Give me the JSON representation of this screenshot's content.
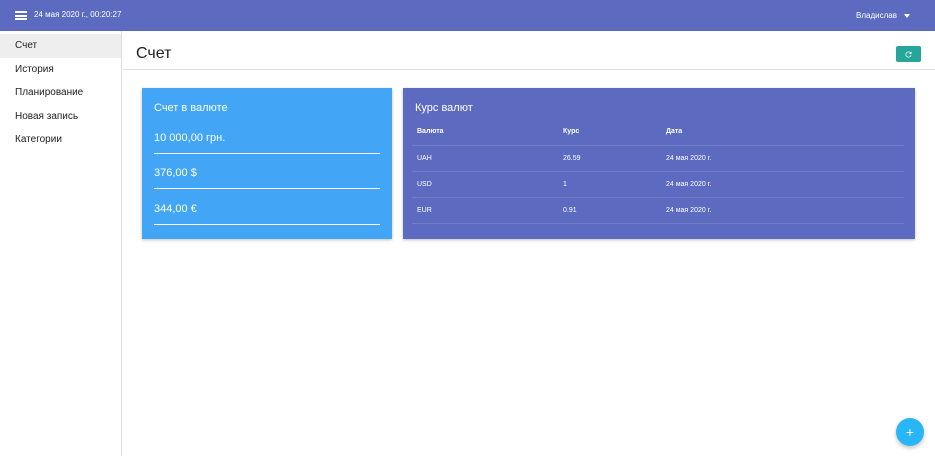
{
  "navbar": {
    "datetime": "24 мая 2020 г., 00:20:27",
    "user": "Владислав"
  },
  "sidebar": {
    "items": [
      {
        "label": "Счет"
      },
      {
        "label": "История"
      },
      {
        "label": "Планирование"
      },
      {
        "label": "Новая запись"
      },
      {
        "label": "Категории"
      }
    ]
  },
  "page": {
    "title": "Счет"
  },
  "account": {
    "title": "Счет в валюте",
    "balances": [
      "10 000,00 грн.",
      "376,00 $",
      "344,00 €"
    ]
  },
  "rates": {
    "title": "Курс валют",
    "headers": [
      "Валюта",
      "Курс",
      "Дата"
    ],
    "rows": [
      [
        "UAH",
        "26.59",
        "24 мая 2020 г."
      ],
      [
        "USD",
        "1",
        "24 мая 2020 г."
      ],
      [
        "EUR",
        "0.91",
        "24 мая 2020 г."
      ]
    ]
  },
  "fab": {
    "label": "+"
  },
  "colors": {
    "navbar": "#5c6bc0",
    "account_card": "#42a5f5",
    "rates_card": "#5c6bc0",
    "refresh_button": "#26a69a",
    "fab": "#29b6f6"
  }
}
